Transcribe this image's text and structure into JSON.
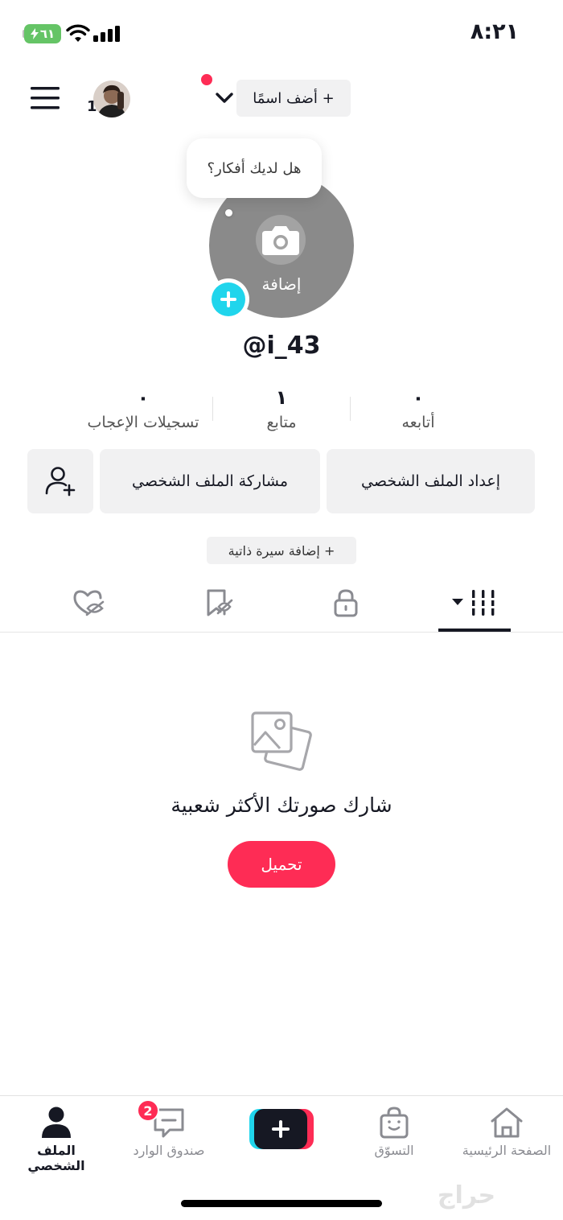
{
  "status_bar": {
    "time": "٨:٢١",
    "battery": "٦١"
  },
  "header": {
    "add_name": "+ أضف اسمًا",
    "avatar_count": "1"
  },
  "profile": {
    "bubble": "هل لديك أفكار؟",
    "add_photo": "إضافة",
    "username": "@i_43"
  },
  "stats": [
    {
      "value": "٠",
      "label": "أتابعه"
    },
    {
      "value": "١",
      "label": "متابع"
    },
    {
      "value": "٠",
      "label": "تسجيلات الإعجاب"
    }
  ],
  "actions": {
    "edit_profile": "إعداد الملف الشخصي",
    "share_profile": "مشاركة الملف الشخصي",
    "add_bio": "+ إضافة سيرة ذاتية"
  },
  "empty_state": {
    "title": "شارك صورتك الأكثر شعبية",
    "upload": "تحميل"
  },
  "bottom_nav": {
    "home": "الصفحة الرئيسية",
    "shop": "التسوّق",
    "inbox": "صندوق الوارد",
    "inbox_badge": "2",
    "profile": "الملف الشخصي"
  },
  "watermark": "حراج",
  "colors": {
    "accent": "#fe2c55",
    "cyan": "#20d5ec",
    "text": "#161823",
    "muted": "#8a8b91"
  }
}
